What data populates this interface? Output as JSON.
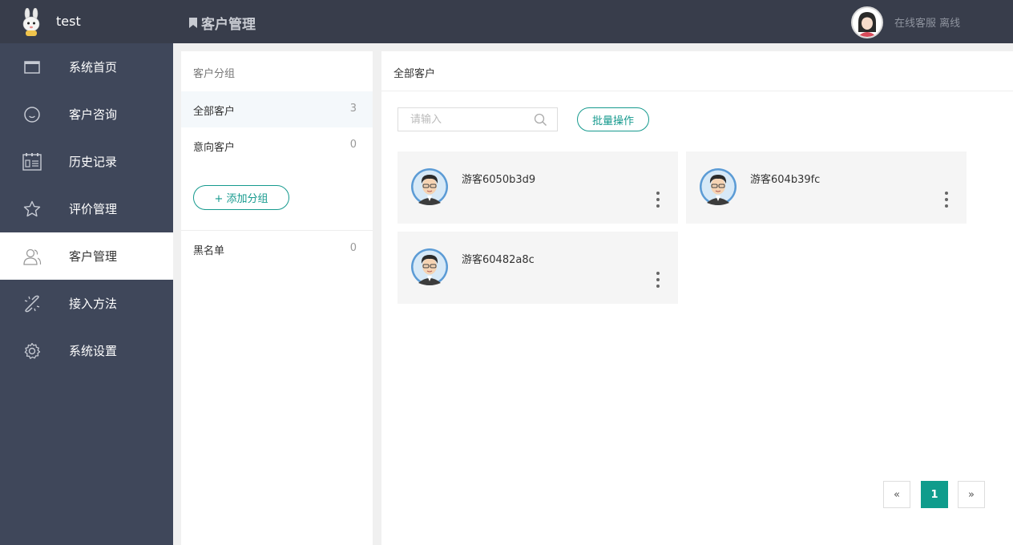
{
  "header": {
    "brand": "test",
    "page_title": "客户管理",
    "status_text": "在线客服 离线"
  },
  "sidebar": {
    "items": [
      {
        "label": "系统首页",
        "icon": "window-icon"
      },
      {
        "label": "客户咨询",
        "icon": "smile-icon"
      },
      {
        "label": "历史记录",
        "icon": "calendar-list-icon"
      },
      {
        "label": "评价管理",
        "icon": "star-icon"
      },
      {
        "label": "客户管理",
        "icon": "users-icon",
        "active": true
      },
      {
        "label": "接入方法",
        "icon": "link-icon"
      },
      {
        "label": "系统设置",
        "icon": "gear-icon"
      }
    ]
  },
  "groups": {
    "title": "客户分组",
    "items": [
      {
        "name": "全部客户",
        "count": "3"
      },
      {
        "name": "意向客户",
        "count": "0"
      }
    ],
    "add_label": "+ 添加分组",
    "blacklist": {
      "name": "黑名单",
      "count": "0"
    }
  },
  "main": {
    "title": "全部客户",
    "search_placeholder": "请输入",
    "batch_label": "批量操作",
    "customers": [
      {
        "name": "游客6050b3d9"
      },
      {
        "name": "游客604b39fc"
      },
      {
        "name": "游客60482a8c"
      }
    ]
  },
  "pagination": {
    "prev": "«",
    "current": "1",
    "next": "»"
  },
  "colors": {
    "accent": "#169a8e",
    "sidebar": "#3f475a",
    "topbar": "#383d4b"
  }
}
